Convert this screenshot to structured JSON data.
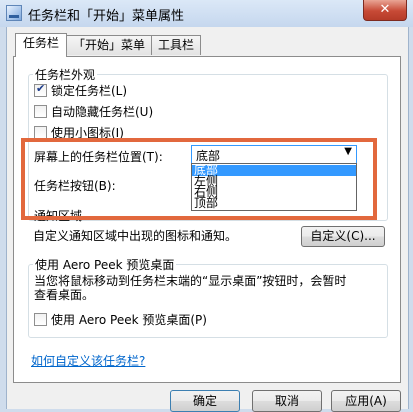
{
  "window": {
    "title": "任务栏和「开始」菜单属性",
    "close_glyph": "✕"
  },
  "tabs": [
    {
      "label": "任务栏",
      "active": true
    },
    {
      "label": "「开始」菜单",
      "active": false
    },
    {
      "label": "工具栏",
      "active": false
    }
  ],
  "appearance": {
    "legend": "任务栏外观",
    "lock_taskbar": {
      "label": "锁定任务栏(L)",
      "checked": true
    },
    "auto_hide": {
      "label": "自动隐藏任务栏(U)",
      "checked": false
    },
    "small_icons": {
      "label": "使用小图标(I)",
      "checked": false
    },
    "location_label": "屏幕上的任务栏位置(T):",
    "location_value": "底部",
    "location_options": [
      "底部",
      "左侧",
      "右侧",
      "顶部"
    ],
    "location_highlighted": "底部",
    "buttons_label": "任务栏按钮(B):"
  },
  "notification": {
    "legend": "通知区域",
    "description": "自定义通知区域中出现的图标和通知。",
    "customize_button": "自定义(C)..."
  },
  "aero_peek": {
    "legend": "使用 Aero Peek 预览桌面",
    "description_line1": "当您将鼠标移动到任务栏末端的“显示桌面”按钮时，会暂时",
    "description_line2": "查看桌面。",
    "checkbox": {
      "label": "使用 Aero Peek 预览桌面(P)",
      "checked": false
    }
  },
  "help_link": "如何自定义该任务栏?",
  "footer": {
    "ok": "确定",
    "cancel": "取消",
    "apply": "应用(A)"
  },
  "colors": {
    "annotation_box": "#e2683d",
    "selection": "#3399ff"
  }
}
